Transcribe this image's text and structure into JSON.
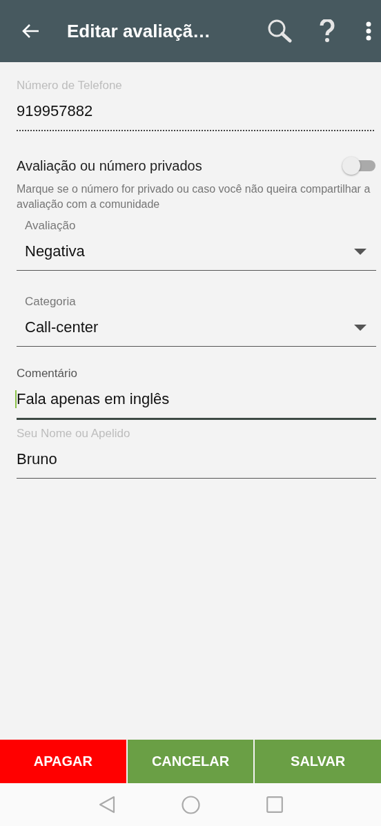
{
  "toolbar": {
    "title": "Editar avaliaçã…"
  },
  "phone_field": {
    "label": "Número de Telefone",
    "value": "919957882",
    "disabled": true
  },
  "privacy": {
    "label": "Avaliação ou número privados",
    "on": false,
    "help": "Marque se o número for privado ou caso você não queira compartilhar a avaliação com a comunidade"
  },
  "fields": [
    {
      "kind": "select",
      "label": "Avaliação",
      "value": "Negativa",
      "focused": false
    },
    {
      "kind": "select",
      "label": "Categoria",
      "value": "Call-center",
      "focused": false
    },
    {
      "kind": "text",
      "label": "Comentário",
      "value": "Fala apenas em inglês",
      "focused": true
    },
    {
      "kind": "text",
      "label": "Seu Nome ou Apelido",
      "value": "Bruno",
      "focused": false
    }
  ],
  "buttons": [
    {
      "label": "APAGAR",
      "color": "#ff0000"
    },
    {
      "label": "CANCELAR",
      "color": "#6a9f45"
    },
    {
      "label": "SALVAR",
      "color": "#6a9f45"
    }
  ]
}
